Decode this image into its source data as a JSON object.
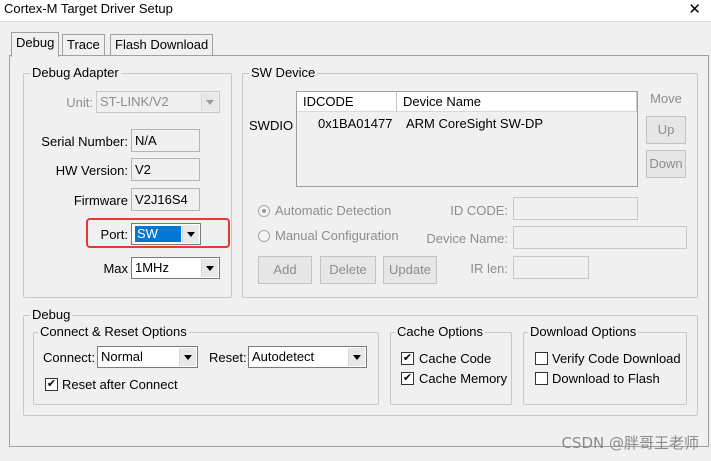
{
  "window": {
    "title": "Cortex-M Target Driver Setup",
    "close": "✕"
  },
  "tabs": [
    {
      "label": "Debug",
      "active": true
    },
    {
      "label": "Trace",
      "active": false
    },
    {
      "label": "Flash Download",
      "active": false
    }
  ],
  "adapter": {
    "group_title": "Debug Adapter",
    "unit_label": "Unit:",
    "unit_value": "ST-LINK/V2",
    "serial_label": "Serial Number:",
    "serial_value": "N/A",
    "hw_label": "HW Version:",
    "hw_value": "V2",
    "fw_label": "Firmware",
    "fw_value": "V2J16S4",
    "port_label": "Port:",
    "port_value": "SW",
    "max_label": "Max",
    "max_value": "1MHz"
  },
  "sw_device": {
    "group_title": "SW Device",
    "row_label": "SWDIO",
    "columns": [
      "IDCODE",
      "Device Name"
    ],
    "rows": [
      {
        "idcode": "0x1BA01477",
        "name": "ARM CoreSight SW-DP"
      }
    ],
    "move_label": "Move",
    "up_label": "Up",
    "down_label": "Down",
    "auto_detect": "Automatic Detection",
    "manual_config": "Manual Configuration",
    "id_code_label": "ID CODE:",
    "device_name_label": "Device Name:",
    "ir_len_label": "IR len:",
    "add_label": "Add",
    "delete_label": "Delete",
    "update_label": "Update"
  },
  "debug": {
    "group_title": "Debug",
    "connect_reset": {
      "title": "Connect & Reset Options",
      "connect_label": "Connect:",
      "connect_value": "Normal",
      "reset_label": "Reset:",
      "reset_value": "Autodetect",
      "reset_after_connect": "Reset after Connect",
      "reset_after_connect_checked": true
    },
    "cache": {
      "title": "Cache Options",
      "cache_code": "Cache Code",
      "cache_code_checked": true,
      "cache_memory": "Cache Memory",
      "cache_memory_checked": true
    },
    "download": {
      "title": "Download Options",
      "verify": "Verify Code Download",
      "verify_checked": false,
      "download_flash": "Download to Flash",
      "download_flash_checked": false
    }
  },
  "watermark": "CSDN @胖哥王老师",
  "colors": {
    "highlight": "#e53935",
    "selection": "#0078d7"
  }
}
